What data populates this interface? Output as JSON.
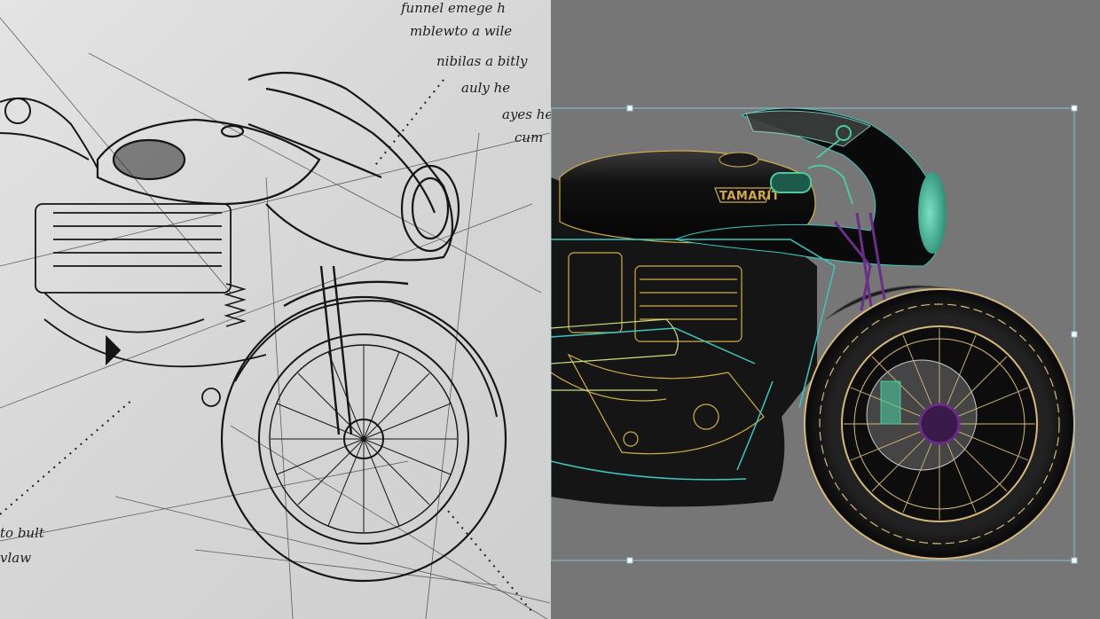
{
  "sketch": {
    "paper_color": "#d8d8d8",
    "ink_color": "#161616",
    "margin_notes": [
      "funnel emege h",
      "mblewto a wile",
      "nibilas a bitly",
      "auly he",
      "ayes he",
      "cum",
      "to bult",
      "vlaw"
    ]
  },
  "vector_render": {
    "background": "#767676",
    "tank_color": "#0c0c0c",
    "brand_badge": "TAMARIT",
    "outline_colors": {
      "frame": "#3cc8c0",
      "engine": "#d4ae4c",
      "wheel": "#d8b87a",
      "fork": "#6a2e86",
      "controls": "#4ec9a0"
    },
    "selection_box_color": "#8fc3d4"
  }
}
